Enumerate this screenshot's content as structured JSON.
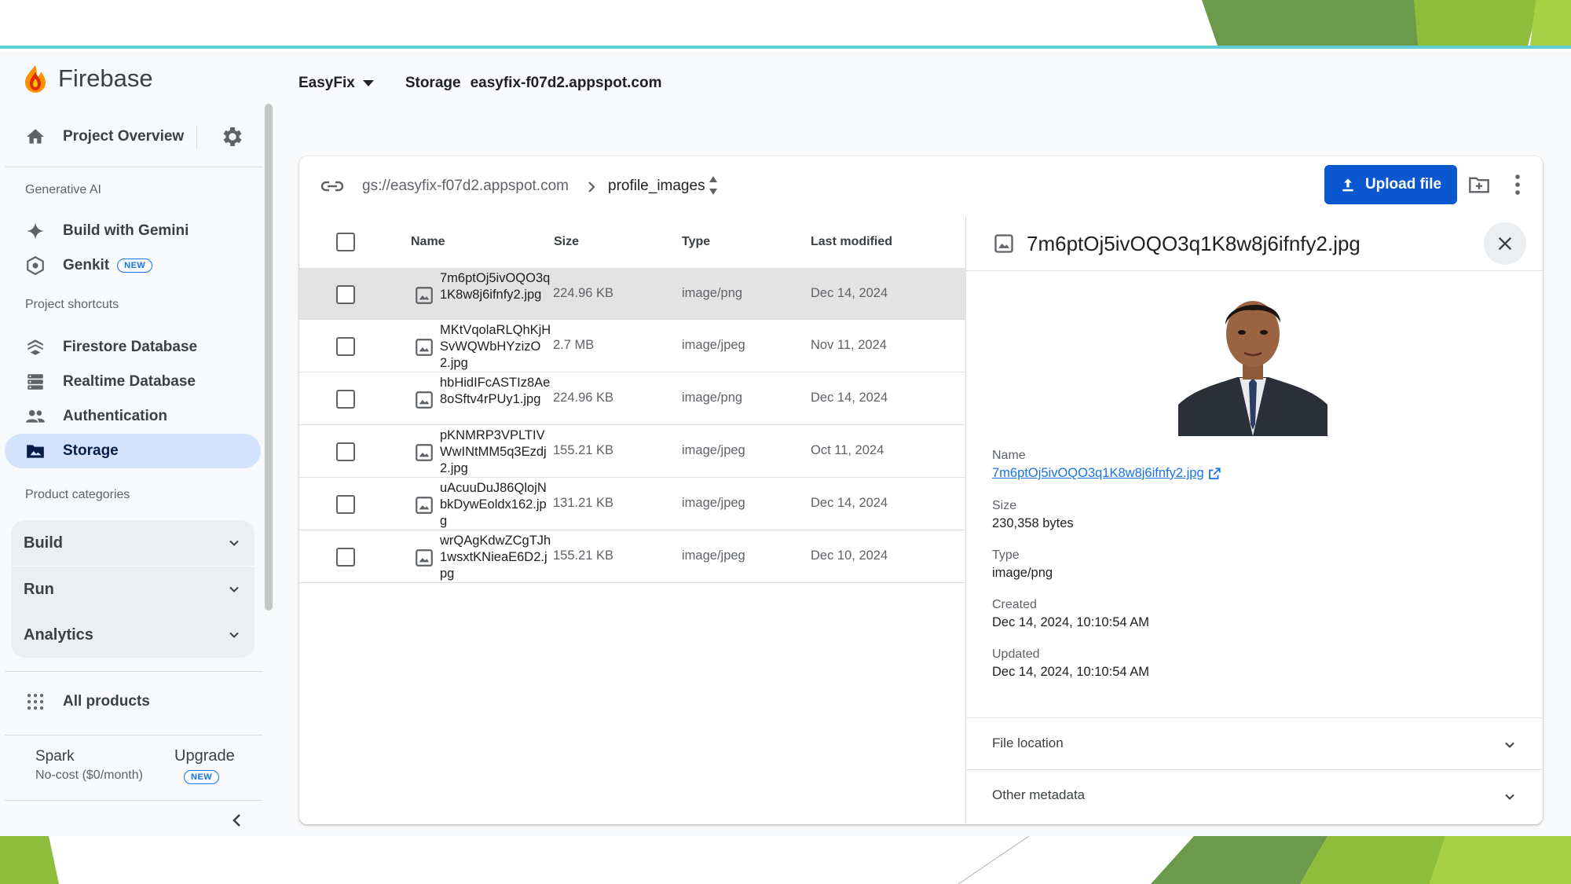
{
  "app": {
    "logo_text": "Firebase"
  },
  "topbar": {
    "project": "EasyFix",
    "product": "Storage",
    "bucket": "easyfix-f07d2.appspot.com"
  },
  "sidebar": {
    "overview": "Project Overview",
    "sections": {
      "gen_ai": "Generative AI",
      "shortcuts": "Project shortcuts",
      "categories": "Product categories"
    },
    "gen_ai_items": [
      {
        "label": "Build with Gemini"
      },
      {
        "label": "Genkit",
        "badge": "NEW"
      }
    ],
    "shortcut_items": [
      {
        "label": "Firestore Database"
      },
      {
        "label": "Realtime Database"
      },
      {
        "label": "Authentication"
      },
      {
        "label": "Storage",
        "active": true
      }
    ],
    "categories": [
      {
        "label": "Build"
      },
      {
        "label": "Run"
      },
      {
        "label": "Analytics"
      }
    ],
    "all_products": "All products",
    "plan": {
      "name": "Spark",
      "sub": "No-cost ($0/month)",
      "upgrade": "Upgrade",
      "badge": "NEW"
    }
  },
  "browser": {
    "bucket_path": "gs://easyfix-f07d2.appspot.com",
    "folder": "profile_images",
    "upload_label": "Upload file",
    "columns": {
      "name": "Name",
      "size": "Size",
      "type": "Type",
      "modified": "Last modified"
    },
    "rows": [
      {
        "name": "7m6ptOj5ivOQO3q1K8w8j6ifnfy2.jpg",
        "size": "224.96 KB",
        "type": "image/png",
        "modified": "Dec 14, 2024"
      },
      {
        "name": "MKtVqolaRLQhKjHSvWQWbHYzizO2.jpg",
        "size": "2.7 MB",
        "type": "image/jpeg",
        "modified": "Nov 11, 2024"
      },
      {
        "name": "hbHidIFcASTIz8Ae8oSftv4rPUy1.jpg",
        "size": "224.96 KB",
        "type": "image/png",
        "modified": "Dec 14, 2024"
      },
      {
        "name": "pKNMRP3VPLTIVWwINtMM5q3Ezdj2.jpg",
        "size": "155.21 KB",
        "type": "image/jpeg",
        "modified": "Oct 11, 2024"
      },
      {
        "name": "uAcuuDuJ86QlojNbkDywEoldx162.jpg",
        "size": "131.21 KB",
        "type": "image/jpeg",
        "modified": "Dec 14, 2024"
      },
      {
        "name": "wrQAgKdwZCgTJh1wsxtKNieaE6D2.jpg",
        "size": "155.21 KB",
        "type": "image/jpeg",
        "modified": "Dec 10, 2024"
      }
    ]
  },
  "detail": {
    "title": "7m6ptOj5ivOQO3q1K8w8j6ifnfy2.jpg",
    "name_label": "Name",
    "name_value": "7m6ptOj5ivOQO3q1K8w8j6ifnfy2.jpg",
    "size_label": "Size",
    "size_value": "230,358 bytes",
    "type_label": "Type",
    "type_value": "image/png",
    "created_label": "Created",
    "created_value": "Dec 14, 2024, 10:10:54 AM",
    "updated_label": "Updated",
    "updated_value": "Dec 14, 2024, 10:10:54 AM",
    "file_location": "File location",
    "other_metadata": "Other metadata"
  },
  "colors": {
    "accent": "#0b57d0",
    "active_nav": "#d3e3fd",
    "selected_row": "#e3e3e3"
  }
}
